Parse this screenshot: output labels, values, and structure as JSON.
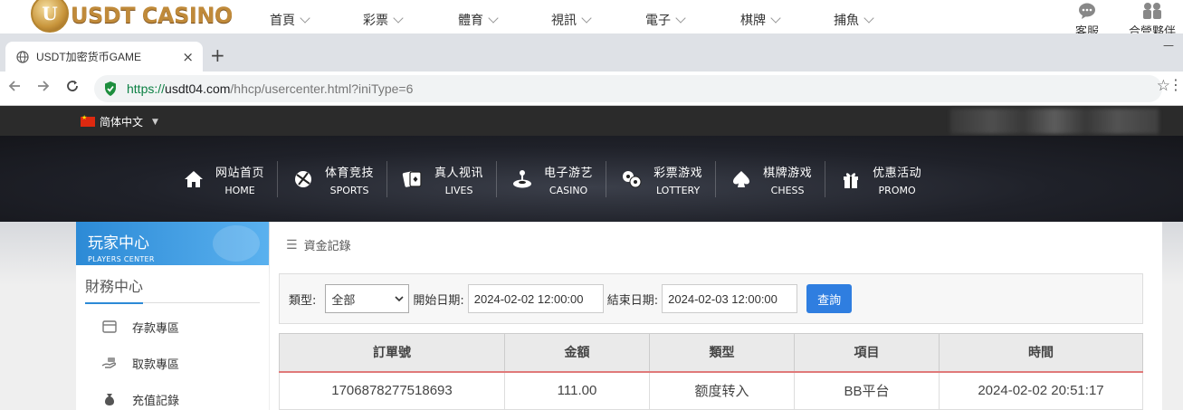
{
  "casino_top": {
    "logo_letter": "U",
    "logo_text": "USDT CASINO",
    "menu": [
      {
        "label": "首頁"
      },
      {
        "label": "彩票"
      },
      {
        "label": "體育"
      },
      {
        "label": "視訊"
      },
      {
        "label": "電子"
      },
      {
        "label": "棋牌"
      },
      {
        "label": "捕魚"
      }
    ],
    "right": [
      {
        "label": "客服",
        "icon": "chat-bubble-icon"
      },
      {
        "label": "合營夥伴",
        "icon": "partners-icon"
      }
    ]
  },
  "browser": {
    "tab_title": "USDT加密货币GAME",
    "tab_close": "×",
    "new_tab": "+",
    "minimize": "—",
    "url_scheme": "https://",
    "url_host": "usdt04.com",
    "url_path": "/hhcp/usercenter.html?iniType=6"
  },
  "site_top": {
    "language": "简体中文"
  },
  "main_nav": [
    {
      "cn": "网站首页",
      "en": "HOME",
      "icon": "home-icon"
    },
    {
      "cn": "体育竞技",
      "en": "SPORTS",
      "icon": "ball-icon"
    },
    {
      "cn": "真人视讯",
      "en": "LIVES",
      "icon": "cards-icon"
    },
    {
      "cn": "电子游艺",
      "en": "CASINO",
      "icon": "joystick-icon"
    },
    {
      "cn": "彩票游戏",
      "en": "LOTTERY",
      "icon": "lottery-balls-icon"
    },
    {
      "cn": "棋牌游戏",
      "en": "CHESS",
      "icon": "spade-icon"
    },
    {
      "cn": "优惠活动",
      "en": "PROMO",
      "icon": "gift-icon"
    }
  ],
  "sidebar": {
    "title": "玩家中心",
    "subtitle": "PLAYERS CENTER",
    "section": "財務中心",
    "items": [
      {
        "label": "存款專區",
        "icon": "deposit-icon"
      },
      {
        "label": "取款專區",
        "icon": "withdraw-icon"
      },
      {
        "label": "充值記錄",
        "icon": "money-bag-icon"
      }
    ]
  },
  "content": {
    "title": "資金記錄",
    "filter": {
      "type_label": "類型:",
      "type_value": "全部",
      "start_label": "開始日期:",
      "start_value": "2024-02-02 12:00:00",
      "end_label": "結束日期:",
      "end_value": "2024-02-03 12:00:00",
      "query_button": "查詢"
    },
    "table": {
      "headers": [
        "訂單號",
        "金額",
        "類型",
        "項目",
        "時間"
      ],
      "rows": [
        [
          "1706878277518693",
          "111.00",
          "额度转入",
          "BB平台",
          "2024-02-02 20:51:17"
        ]
      ]
    }
  }
}
